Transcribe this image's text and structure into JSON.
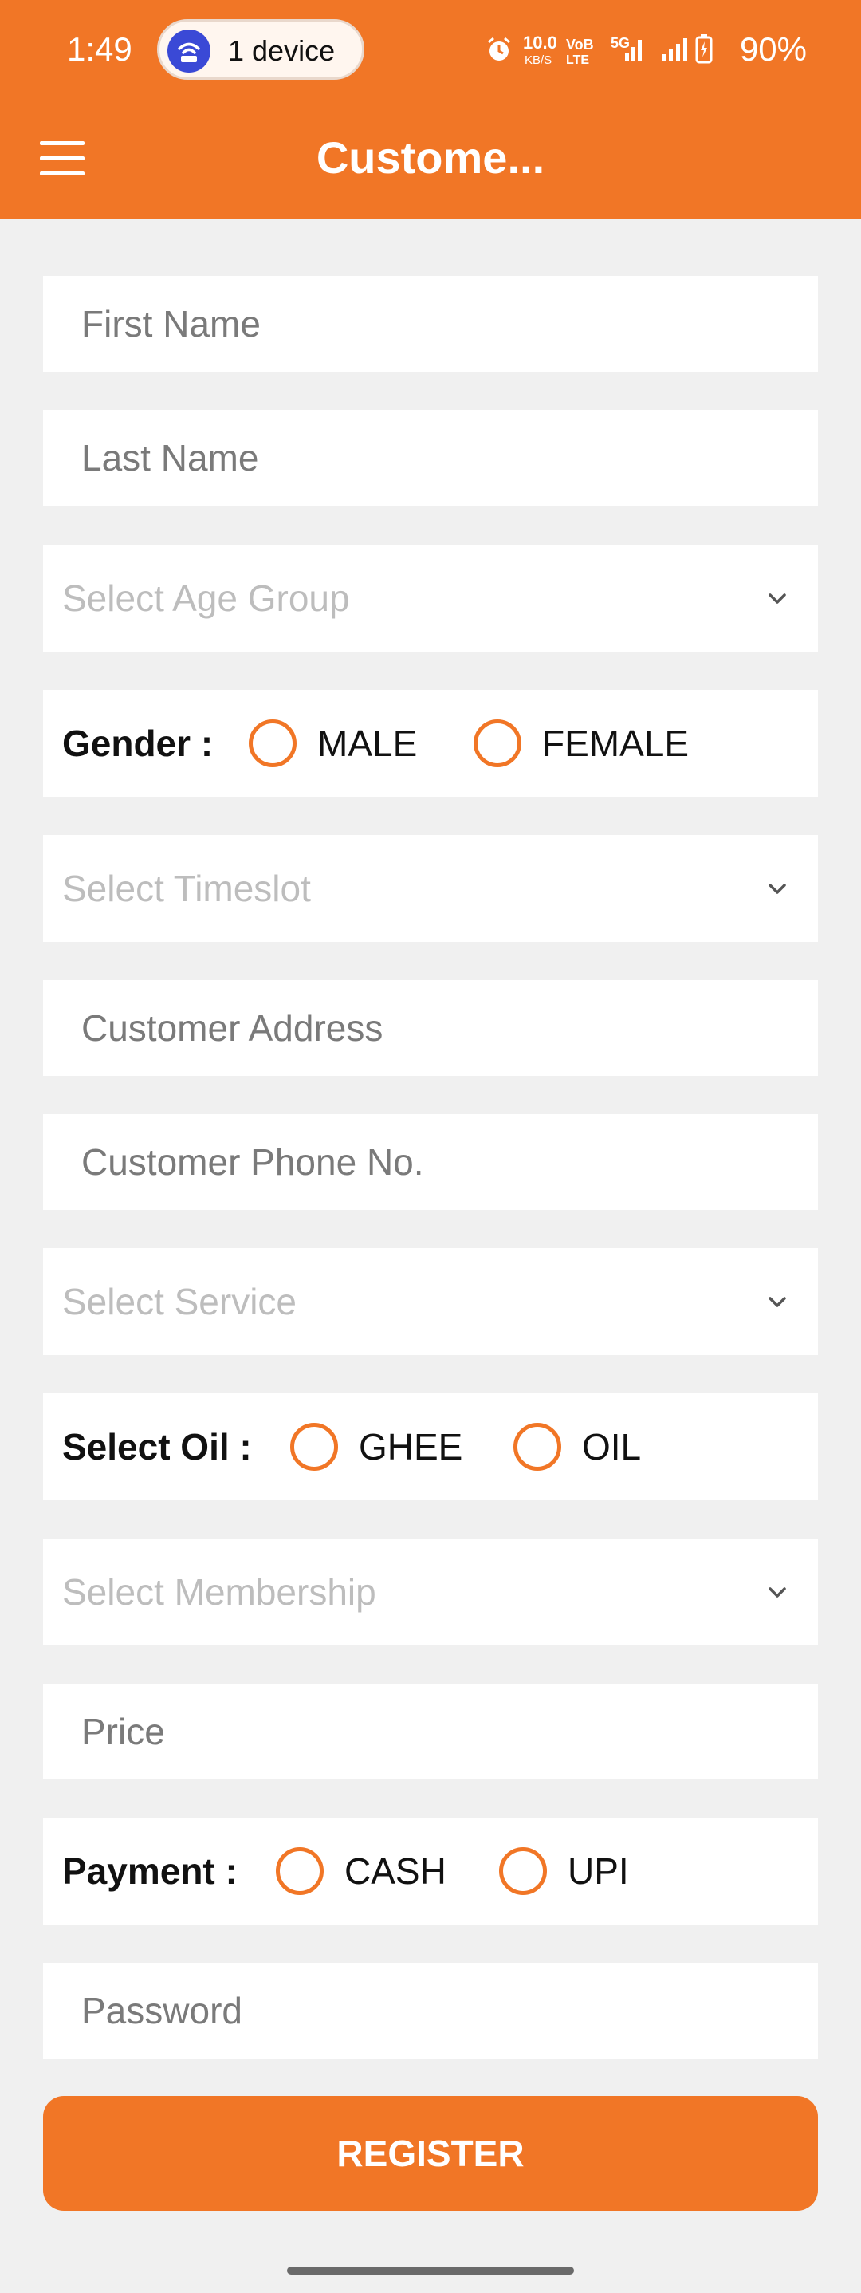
{
  "status_bar": {
    "time": "1:49",
    "hotspot_label": "1 device",
    "net_speed_value": "10.0",
    "net_speed_unit": "KB/S",
    "volte_top": "VoB",
    "volte_bottom": "LTE",
    "network_type": "5G",
    "battery": "90%"
  },
  "toolbar": {
    "title": "Custome..."
  },
  "form": {
    "first_name_placeholder": "First Name",
    "last_name_placeholder": "Last Name",
    "age_group_placeholder": "Select Age Group",
    "gender_label": "Gender :",
    "gender_options": [
      "MALE",
      "FEMALE"
    ],
    "timeslot_placeholder": "Select Timeslot",
    "address_placeholder": "Customer Address",
    "phone_placeholder": "Customer Phone No.",
    "service_placeholder": "Select Service",
    "oil_label": "Select Oil :",
    "oil_options": [
      "GHEE",
      "OIL"
    ],
    "membership_placeholder": "Select Membership",
    "price_placeholder": "Price",
    "payment_label": "Payment :",
    "payment_options": [
      "CASH",
      "UPI"
    ],
    "password_placeholder": "Password"
  },
  "register_label": "REGISTER",
  "colors": {
    "accent": "#f17626",
    "background": "#f0f0f0"
  }
}
